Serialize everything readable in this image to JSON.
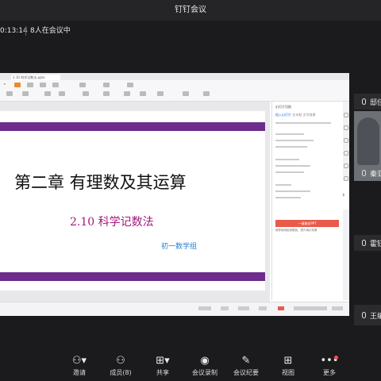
{
  "window": {
    "title": "钉钉会议"
  },
  "status": {
    "elapsed": "0:13:14",
    "participants": "8人在会议中"
  },
  "shared": {
    "file_tab": "2.10 科学记数法.pptx",
    "slide": {
      "title": "第二章 有理数及其运算",
      "subtitle": "2.10 科学记数法",
      "group": "初一数学组"
    },
    "pane": {
      "title": "幻灯片切换",
      "tabs": [
        "插入幻灯片",
        "文本框",
        "文字效果"
      ],
      "button": "一键美化PPT",
      "note": "推荐使用稻壳模板，提升演示效果"
    }
  },
  "participants": [
    {
      "name": "邸佳"
    },
    {
      "name": "秦亚"
    },
    {
      "name": "霍钰"
    },
    {
      "name": "王编"
    }
  ],
  "toolbar": [
    {
      "label": "邀请",
      "icon": "add-person-icon"
    },
    {
      "label": "成员(8)",
      "icon": "members-icon"
    },
    {
      "label": "共享",
      "icon": "share-screen-icon"
    },
    {
      "label": "会议录制",
      "icon": "record-icon"
    },
    {
      "label": "会议纪要",
      "icon": "minutes-icon"
    },
    {
      "label": "视图",
      "icon": "grid-view-icon"
    },
    {
      "label": "更多",
      "icon": "more-icon"
    }
  ]
}
